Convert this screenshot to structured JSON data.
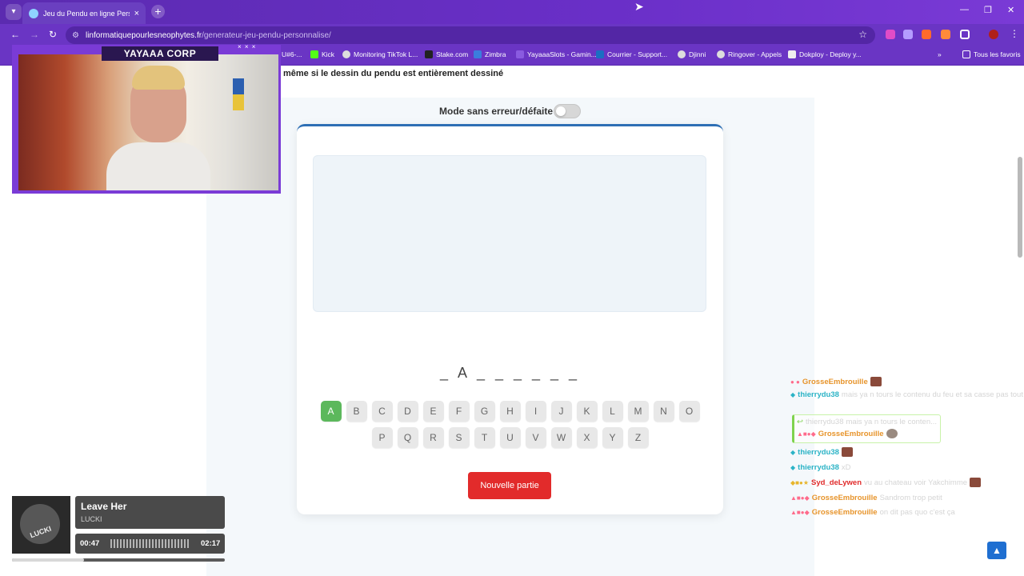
{
  "browser": {
    "tab_title": "Jeu du Pendu en ligne Personnalis",
    "url_domain": "linformatiquepourlesneophytes.fr",
    "url_path": "/generateur-jeu-pendu-personnalise/",
    "bookmarks": [
      "U#6-...",
      "Kick",
      "Monitoring TikTok L...",
      "Stake.com",
      "Zimbra",
      "YayaaaSlots - Gamin...",
      "Courrier - Support...",
      "Djinni",
      "Ringover - Appels",
      "Dokploy - Deploy y...",
      "Tous les favoris"
    ]
  },
  "page": {
    "intro_text": "même si le dessin du pendu est entièrement dessiné",
    "mode_label": "Mode sans erreur/défaite :",
    "word_display": "_ A _ _ _ _ _ _",
    "keys_row1": [
      "A",
      "B",
      "C",
      "D",
      "E",
      "F",
      "G",
      "H",
      "I",
      "J",
      "K",
      "L",
      "M",
      "N",
      "O"
    ],
    "keys_row2": [
      "P",
      "Q",
      "R",
      "S",
      "T",
      "U",
      "V",
      "W",
      "X",
      "Y",
      "Z"
    ],
    "used_letters": [
      "A"
    ],
    "new_game_label": "Nouvelle partie"
  },
  "overlay": {
    "webcam_label": "YAYAAA CORP",
    "webcam_deco": "× × ×",
    "chat": [
      {
        "user": "GrosseEmbrouille",
        "msg": ""
      },
      {
        "user": "thierrydu38",
        "msg": "mais ya n tours le contenu du feu et sa casse pas tout"
      },
      {
        "user": "thierrydu38",
        "msg": "mais ya n tours le conten..."
      },
      {
        "user": "GrosseEmbrouille",
        "msg": ""
      },
      {
        "user": "thierrydu38",
        "msg": ""
      },
      {
        "user": "thierrydu38",
        "msg": "xD"
      },
      {
        "user": "Syd_deLywen",
        "msg": "vu au chateau voir Yakchimme"
      },
      {
        "user": "GrosseEmbrouille",
        "msg": "Sandrom trop petit"
      },
      {
        "user": "GrosseEmbrouille",
        "msg": "on dit pas quo c'est ça"
      }
    ],
    "music": {
      "title": "Leave Her",
      "artist": "LUCKI",
      "elapsed": "00:47",
      "total": "02:17",
      "cover_text": "LUCKI"
    }
  },
  "colors": {
    "browser_purple": "#6a35c4",
    "key_used": "#5cb85c",
    "new_game": "#e22b2b",
    "card_top": "#2e6fb5"
  }
}
